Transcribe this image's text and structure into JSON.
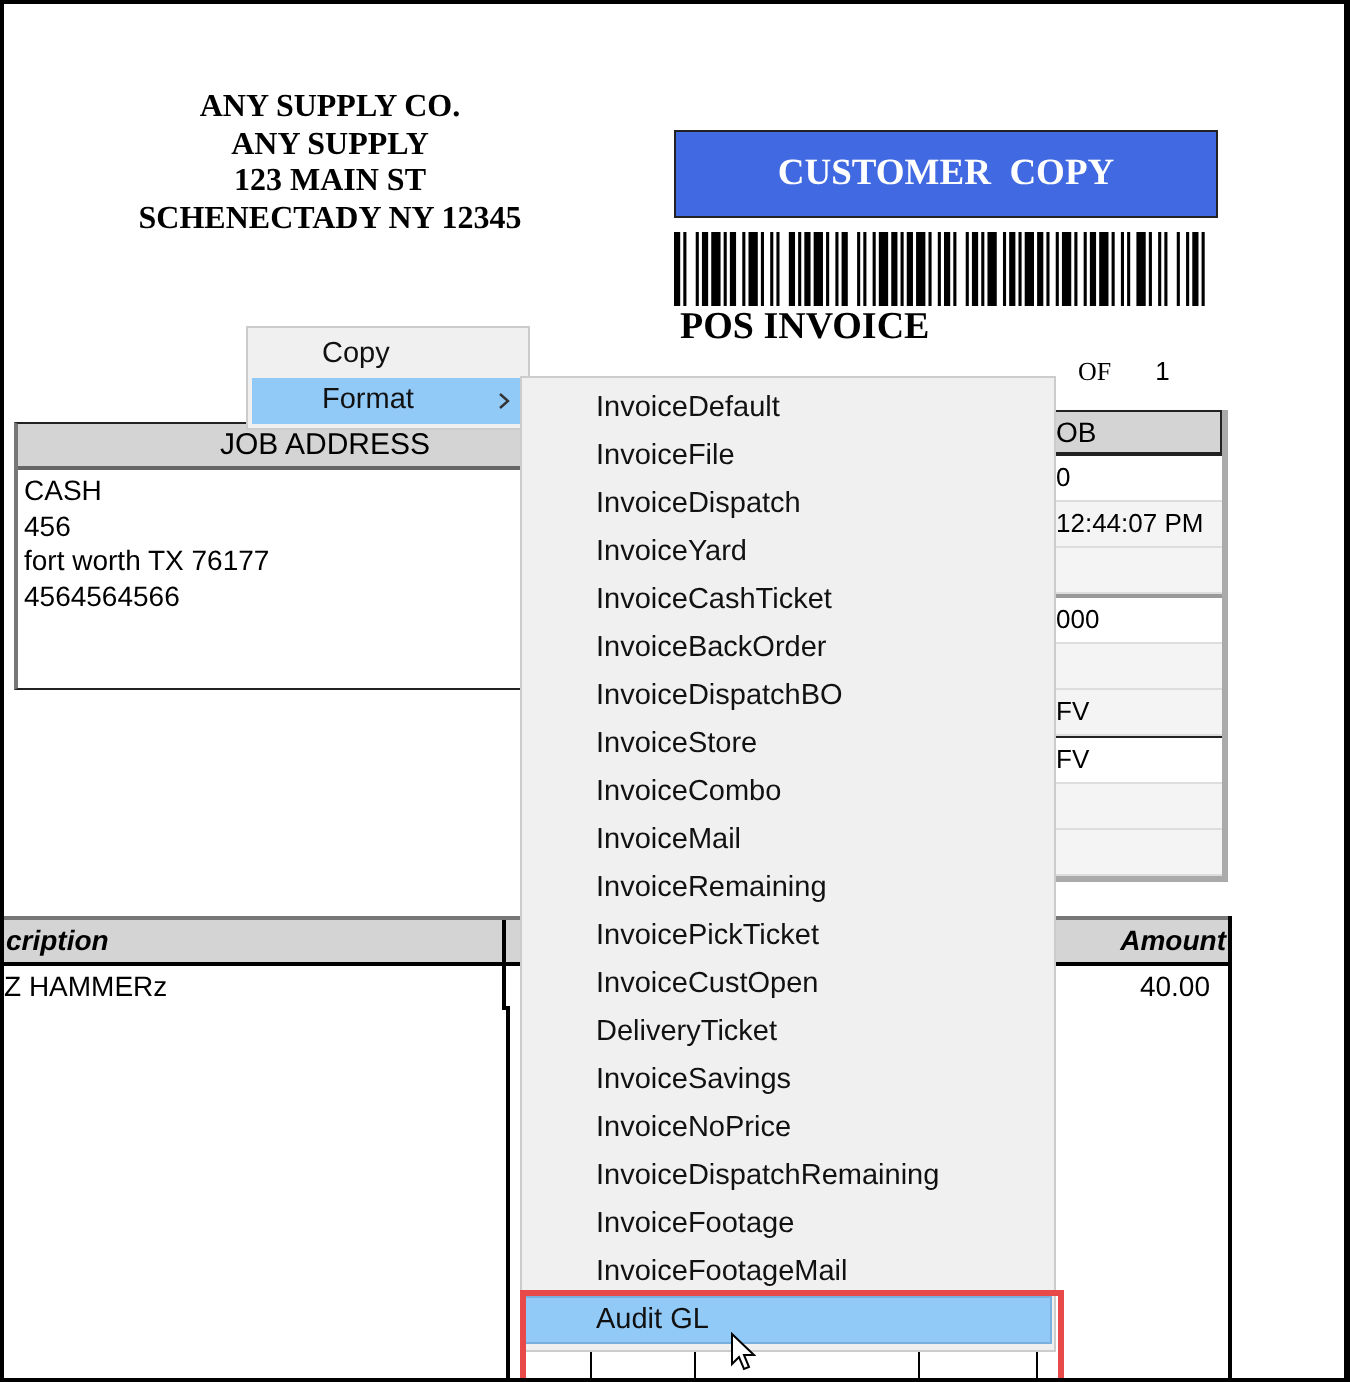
{
  "company": {
    "lines": [
      "ANY SUPPLY CO.",
      "ANY SUPPLY",
      "123 MAIN ST",
      "SCHENECTADY NY 12345"
    ]
  },
  "copy_banner": "CUSTOMER  COPY",
  "document_title": "POS INVOICE",
  "page_count": {
    "label": "OF",
    "value": "1"
  },
  "job_address": {
    "title": "JOB ADDRESS",
    "lines": [
      "CASH",
      "456",
      "fort worth TX 76177",
      "4564564566"
    ]
  },
  "side_panel": {
    "title": "OB",
    "rows": [
      {
        "text": "0"
      },
      {
        "text": "12:44:07 PM"
      },
      {},
      {
        "text": "000"
      },
      {},
      {
        "text": "FV"
      },
      {
        "text": "FV"
      },
      {},
      {}
    ]
  },
  "items_table": {
    "columns": [
      {
        "label": "cription"
      },
      {
        "label": "Amount"
      }
    ],
    "rows": [
      {
        "cells": [
          "Z HAMMERz",
          "40.00"
        ]
      }
    ]
  },
  "context_menu": {
    "items": [
      {
        "label": "Copy",
        "selected": false,
        "has_submenu": false
      },
      {
        "label": "Format",
        "selected": true,
        "has_submenu": true
      }
    ]
  },
  "submenu": {
    "items": [
      {
        "label": "InvoiceDefault",
        "selected": false
      },
      {
        "label": "InvoiceFile",
        "selected": false
      },
      {
        "label": "InvoiceDispatch",
        "selected": false
      },
      {
        "label": "InvoiceYard",
        "selected": false
      },
      {
        "label": "InvoiceCashTicket",
        "selected": false
      },
      {
        "label": "InvoiceBackOrder",
        "selected": false
      },
      {
        "label": "InvoiceDispatchBO",
        "selected": false
      },
      {
        "label": "InvoiceStore",
        "selected": false
      },
      {
        "label": "InvoiceCombo",
        "selected": false
      },
      {
        "label": "InvoiceMail",
        "selected": false
      },
      {
        "label": "InvoiceRemaining",
        "selected": false
      },
      {
        "label": "InvoicePickTicket",
        "selected": false
      },
      {
        "label": "InvoiceCustOpen",
        "selected": false
      },
      {
        "label": "DeliveryTicket",
        "selected": false
      },
      {
        "label": "InvoiceSavings",
        "selected": false
      },
      {
        "label": "InvoiceNoPrice",
        "selected": false
      },
      {
        "label": "InvoiceDispatchRemaining",
        "selected": false
      },
      {
        "label": "InvoiceFootage",
        "selected": false
      },
      {
        "label": "InvoiceFootageMail",
        "selected": false
      },
      {
        "label": "Audit GL",
        "selected": true
      }
    ]
  }
}
